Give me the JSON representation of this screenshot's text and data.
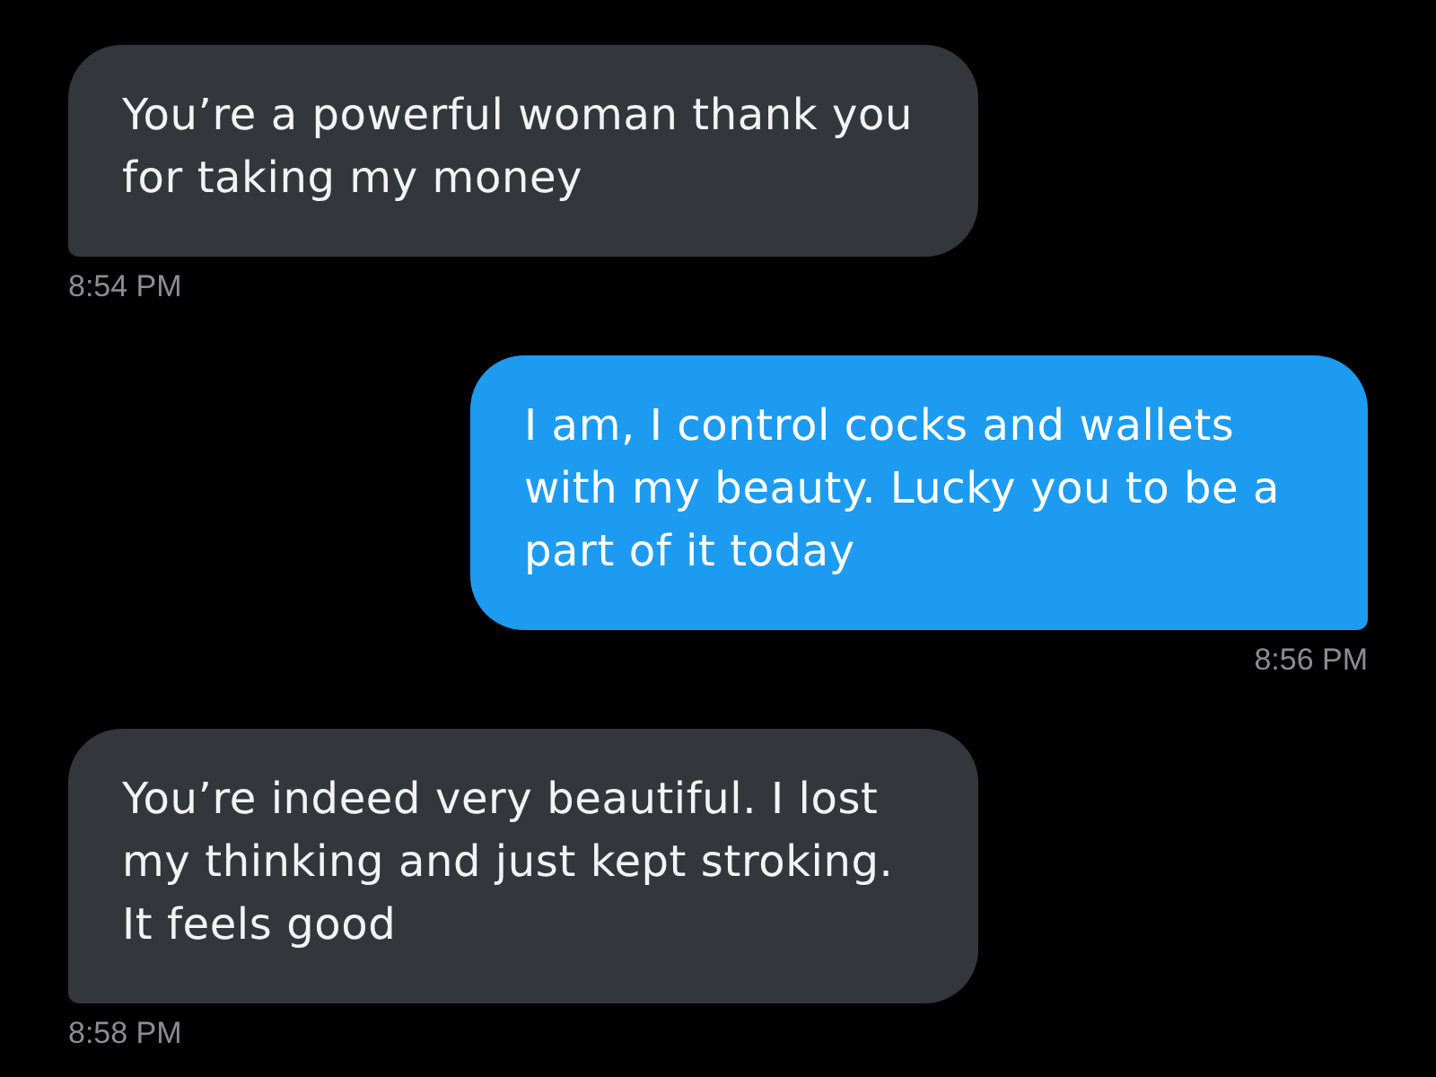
{
  "messages": [
    {
      "kind": "received",
      "text": "You’re a powerful woman thank you for taking my money",
      "time": "8:54 PM"
    },
    {
      "kind": "sent",
      "text": "I am, I control cocks and wallets with my beauty. Lucky you to be a part of it today",
      "time": "8:56 PM"
    },
    {
      "kind": "received",
      "text": "You’re indeed very beautiful. I lost my thinking and just kept stroking. It feels good",
      "time": "8:58 PM"
    }
  ]
}
